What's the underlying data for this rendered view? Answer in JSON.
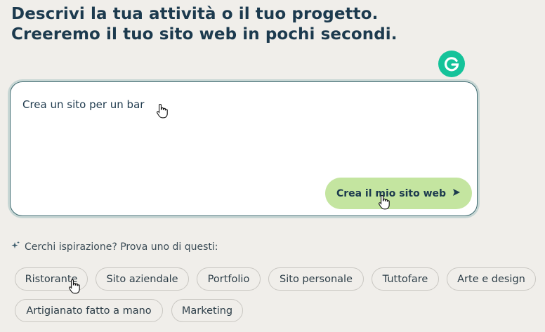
{
  "headline": {
    "line1": "Descrivi la tua attività o il tuo progetto.",
    "line2": "Creeremo il tuo sito web in pochi secondi."
  },
  "extension_icon": "grammarly-icon",
  "prompt": {
    "value": "Crea un sito per un bar",
    "submit_label": "Crea il mio sito web",
    "submit_icon": "send-arrow-icon"
  },
  "inspiration": {
    "icon": "sparkle-icon",
    "label": "Cerchi ispirazione? Prova uno di questi:"
  },
  "chips": [
    "Ristorante",
    "Sito aziendale",
    "Portfolio",
    "Sito personale",
    "Tuttofare",
    "Arte e design",
    "Artigianato fatto a mano",
    "Marketing"
  ],
  "colors": {
    "background": "#f0eeea",
    "heading": "#1c3a4e",
    "button": "#c4e5a0",
    "box_border": "#3f6b71",
    "grammarly": "#15c39a"
  }
}
